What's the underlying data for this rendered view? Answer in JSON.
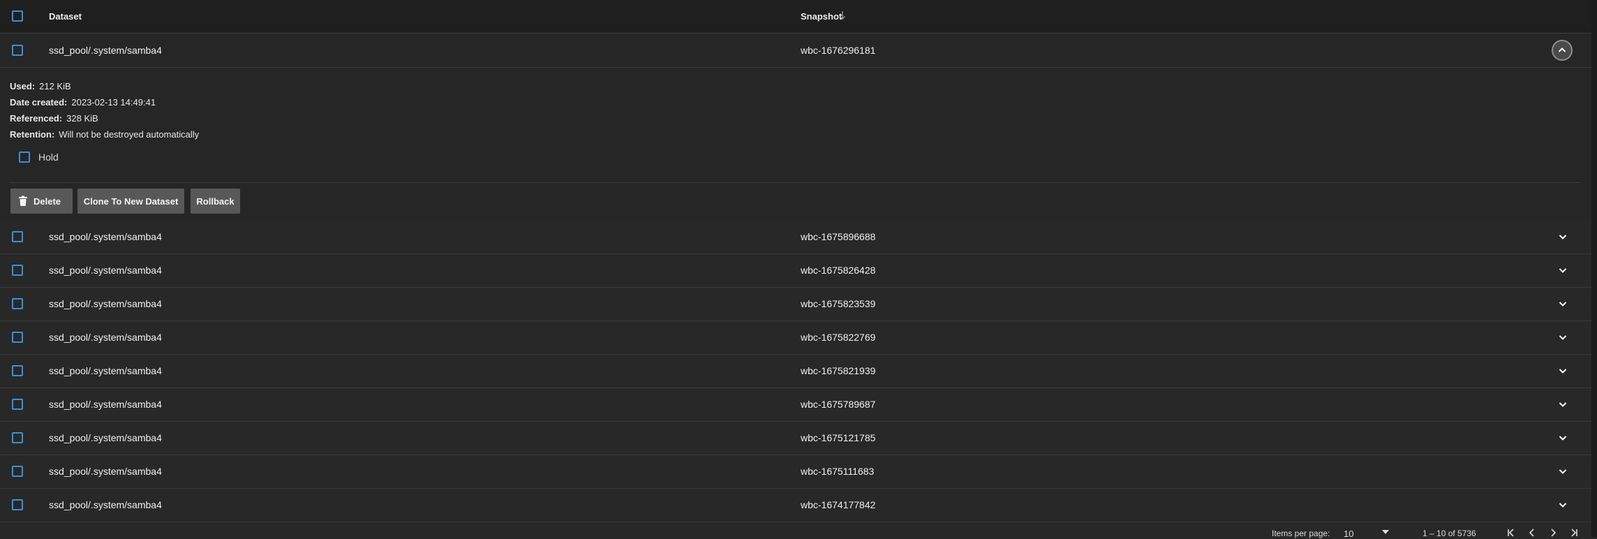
{
  "header": {
    "col_dataset": "Dataset",
    "col_snapshot": "Snapshot"
  },
  "expanded": {
    "dataset": "ssd_pool/.system/samba4",
    "snapshot": "wbc-1676296181",
    "used_label": "Used:",
    "used_value": "212 KiB",
    "date_label": "Date created:",
    "date_value": "2023-02-13 14:49:41",
    "referenced_label": "Referenced:",
    "referenced_value": "328 KiB",
    "retention_label": "Retention:",
    "retention_value": "Will not be destroyed automatically",
    "hold_label": "Hold",
    "buttons": {
      "delete": "Delete",
      "clone": "Clone To New Dataset",
      "rollback": "Rollback"
    }
  },
  "rows": [
    {
      "dataset": "ssd_pool/.system/samba4",
      "snapshot": "wbc-1675896688"
    },
    {
      "dataset": "ssd_pool/.system/samba4",
      "snapshot": "wbc-1675826428"
    },
    {
      "dataset": "ssd_pool/.system/samba4",
      "snapshot": "wbc-1675823539"
    },
    {
      "dataset": "ssd_pool/.system/samba4",
      "snapshot": "wbc-1675822769"
    },
    {
      "dataset": "ssd_pool/.system/samba4",
      "snapshot": "wbc-1675821939"
    },
    {
      "dataset": "ssd_pool/.system/samba4",
      "snapshot": "wbc-1675789687"
    },
    {
      "dataset": "ssd_pool/.system/samba4",
      "snapshot": "wbc-1675121785"
    },
    {
      "dataset": "ssd_pool/.system/samba4",
      "snapshot": "wbc-1675111683"
    },
    {
      "dataset": "ssd_pool/.system/samba4",
      "snapshot": "wbc-1674177842"
    }
  ],
  "paginator": {
    "items_per_page_label": "Items per page:",
    "items_per_page_value": "10",
    "range_label": "1 – 10 of 5736"
  },
  "colors": {
    "checkbox_border": "#3d8fd6",
    "button_bg": "#585858",
    "header_bg": "#1f1f1f",
    "row_bg": "#282828"
  }
}
